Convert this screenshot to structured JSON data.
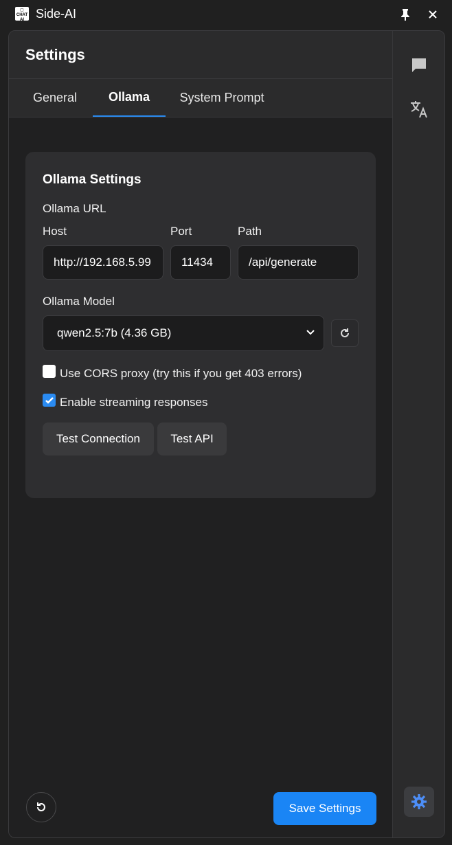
{
  "window": {
    "title": "Side-AI",
    "logo_text": "CHAT AI"
  },
  "header": {
    "title": "Settings"
  },
  "tabs": [
    {
      "label": "General"
    },
    {
      "label": "Ollama",
      "active": true
    },
    {
      "label": "System Prompt"
    }
  ],
  "ollama": {
    "card_title": "Ollama Settings",
    "url_label": "Ollama URL",
    "host_label": "Host",
    "port_label": "Port",
    "path_label": "Path",
    "host_value": "http://192.168.5.99",
    "port_value": "11434",
    "path_value": "/api/generate",
    "model_label": "Ollama Model",
    "model_selected": "qwen2.5:7b (4.36 GB)",
    "cors_label": "Use CORS proxy (try this if you get 403 errors)",
    "cors_checked": false,
    "streaming_label": "Enable streaming responses",
    "streaming_checked": true,
    "test_connection_label": "Test Connection",
    "test_api_label": "Test API"
  },
  "footer": {
    "save_label": "Save Settings"
  },
  "sidebar": {
    "items": [
      {
        "icon": "chat-icon"
      },
      {
        "icon": "translate-icon"
      },
      {
        "icon": "gear-icon",
        "active": true
      }
    ]
  },
  "colors": {
    "accent": "#1a85f5",
    "background": "#202020",
    "panel": "#2e2e30"
  }
}
